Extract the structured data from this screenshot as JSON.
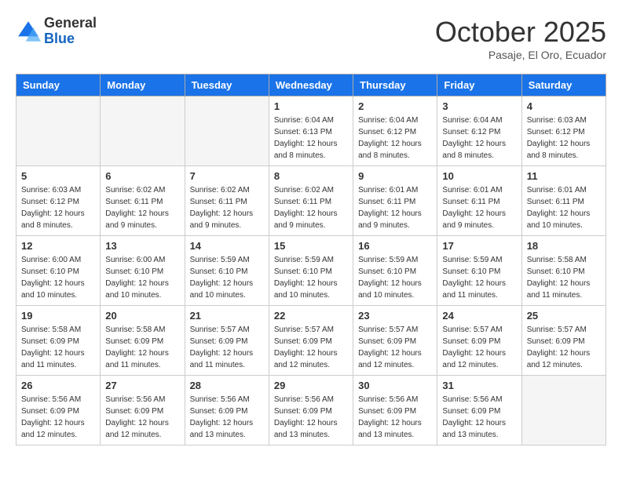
{
  "header": {
    "logo_general": "General",
    "logo_blue": "Blue",
    "month_year": "October 2025",
    "location": "Pasaje, El Oro, Ecuador"
  },
  "days_of_week": [
    "Sunday",
    "Monday",
    "Tuesday",
    "Wednesday",
    "Thursday",
    "Friday",
    "Saturday"
  ],
  "weeks": [
    [
      {
        "day": "",
        "info": ""
      },
      {
        "day": "",
        "info": ""
      },
      {
        "day": "",
        "info": ""
      },
      {
        "day": "1",
        "info": "Sunrise: 6:04 AM\nSunset: 6:13 PM\nDaylight: 12 hours\nand 8 minutes."
      },
      {
        "day": "2",
        "info": "Sunrise: 6:04 AM\nSunset: 6:12 PM\nDaylight: 12 hours\nand 8 minutes."
      },
      {
        "day": "3",
        "info": "Sunrise: 6:04 AM\nSunset: 6:12 PM\nDaylight: 12 hours\nand 8 minutes."
      },
      {
        "day": "4",
        "info": "Sunrise: 6:03 AM\nSunset: 6:12 PM\nDaylight: 12 hours\nand 8 minutes."
      }
    ],
    [
      {
        "day": "5",
        "info": "Sunrise: 6:03 AM\nSunset: 6:12 PM\nDaylight: 12 hours\nand 8 minutes."
      },
      {
        "day": "6",
        "info": "Sunrise: 6:02 AM\nSunset: 6:11 PM\nDaylight: 12 hours\nand 9 minutes."
      },
      {
        "day": "7",
        "info": "Sunrise: 6:02 AM\nSunset: 6:11 PM\nDaylight: 12 hours\nand 9 minutes."
      },
      {
        "day": "8",
        "info": "Sunrise: 6:02 AM\nSunset: 6:11 PM\nDaylight: 12 hours\nand 9 minutes."
      },
      {
        "day": "9",
        "info": "Sunrise: 6:01 AM\nSunset: 6:11 PM\nDaylight: 12 hours\nand 9 minutes."
      },
      {
        "day": "10",
        "info": "Sunrise: 6:01 AM\nSunset: 6:11 PM\nDaylight: 12 hours\nand 9 minutes."
      },
      {
        "day": "11",
        "info": "Sunrise: 6:01 AM\nSunset: 6:11 PM\nDaylight: 12 hours\nand 10 minutes."
      }
    ],
    [
      {
        "day": "12",
        "info": "Sunrise: 6:00 AM\nSunset: 6:10 PM\nDaylight: 12 hours\nand 10 minutes."
      },
      {
        "day": "13",
        "info": "Sunrise: 6:00 AM\nSunset: 6:10 PM\nDaylight: 12 hours\nand 10 minutes."
      },
      {
        "day": "14",
        "info": "Sunrise: 5:59 AM\nSunset: 6:10 PM\nDaylight: 12 hours\nand 10 minutes."
      },
      {
        "day": "15",
        "info": "Sunrise: 5:59 AM\nSunset: 6:10 PM\nDaylight: 12 hours\nand 10 minutes."
      },
      {
        "day": "16",
        "info": "Sunrise: 5:59 AM\nSunset: 6:10 PM\nDaylight: 12 hours\nand 10 minutes."
      },
      {
        "day": "17",
        "info": "Sunrise: 5:59 AM\nSunset: 6:10 PM\nDaylight: 12 hours\nand 11 minutes."
      },
      {
        "day": "18",
        "info": "Sunrise: 5:58 AM\nSunset: 6:10 PM\nDaylight: 12 hours\nand 11 minutes."
      }
    ],
    [
      {
        "day": "19",
        "info": "Sunrise: 5:58 AM\nSunset: 6:09 PM\nDaylight: 12 hours\nand 11 minutes."
      },
      {
        "day": "20",
        "info": "Sunrise: 5:58 AM\nSunset: 6:09 PM\nDaylight: 12 hours\nand 11 minutes."
      },
      {
        "day": "21",
        "info": "Sunrise: 5:57 AM\nSunset: 6:09 PM\nDaylight: 12 hours\nand 11 minutes."
      },
      {
        "day": "22",
        "info": "Sunrise: 5:57 AM\nSunset: 6:09 PM\nDaylight: 12 hours\nand 12 minutes."
      },
      {
        "day": "23",
        "info": "Sunrise: 5:57 AM\nSunset: 6:09 PM\nDaylight: 12 hours\nand 12 minutes."
      },
      {
        "day": "24",
        "info": "Sunrise: 5:57 AM\nSunset: 6:09 PM\nDaylight: 12 hours\nand 12 minutes."
      },
      {
        "day": "25",
        "info": "Sunrise: 5:57 AM\nSunset: 6:09 PM\nDaylight: 12 hours\nand 12 minutes."
      }
    ],
    [
      {
        "day": "26",
        "info": "Sunrise: 5:56 AM\nSunset: 6:09 PM\nDaylight: 12 hours\nand 12 minutes."
      },
      {
        "day": "27",
        "info": "Sunrise: 5:56 AM\nSunset: 6:09 PM\nDaylight: 12 hours\nand 12 minutes."
      },
      {
        "day": "28",
        "info": "Sunrise: 5:56 AM\nSunset: 6:09 PM\nDaylight: 12 hours\nand 13 minutes."
      },
      {
        "day": "29",
        "info": "Sunrise: 5:56 AM\nSunset: 6:09 PM\nDaylight: 12 hours\nand 13 minutes."
      },
      {
        "day": "30",
        "info": "Sunrise: 5:56 AM\nSunset: 6:09 PM\nDaylight: 12 hours\nand 13 minutes."
      },
      {
        "day": "31",
        "info": "Sunrise: 5:56 AM\nSunset: 6:09 PM\nDaylight: 12 hours\nand 13 minutes."
      },
      {
        "day": "",
        "info": ""
      }
    ]
  ]
}
